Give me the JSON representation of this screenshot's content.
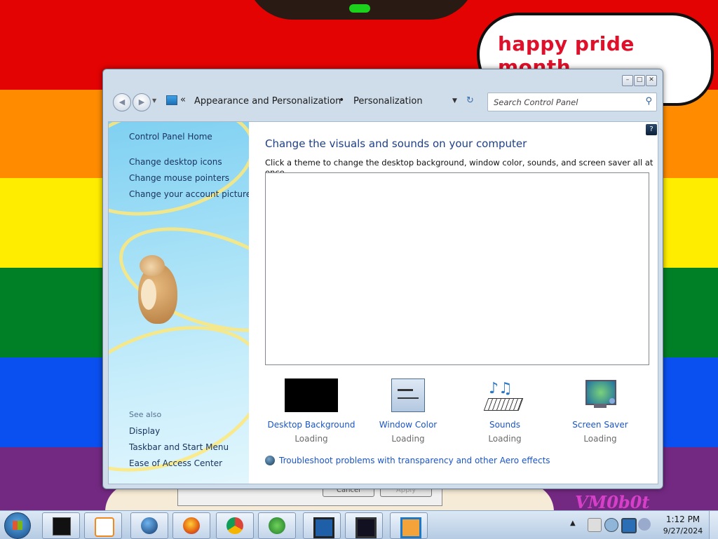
{
  "wallpaper": {
    "stripe_colors": [
      "#e40303",
      "#ff8c00",
      "#ffed00",
      "#008026",
      "#0a4ff0",
      "#732982"
    ],
    "speech_bubble_text": "happy pride month",
    "vm_logo_text": "VM0b0t"
  },
  "background_dialog": {
    "cancel_label": "Cancel",
    "apply_label": "Apply"
  },
  "window": {
    "breadcrumb": {
      "prefix": "«",
      "items": [
        "Appearance and Personalization",
        "Personalization"
      ],
      "separator": "•"
    },
    "search": {
      "placeholder": "Search Control Panel"
    },
    "left_pane": {
      "home_link": "Control Panel Home",
      "tasks": [
        "Change desktop icons",
        "Change mouse pointers",
        "Change your account picture"
      ],
      "see_also_heading": "See also",
      "see_also": [
        "Display",
        "Taskbar and Start Menu",
        "Ease of Access Center"
      ]
    },
    "main": {
      "help_glyph": "?",
      "title": "Change the visuals and sounds on your computer",
      "subtitle": "Click a theme to change the desktop background, window color, sounds, and screen saver all at once.",
      "options": [
        {
          "label": "Desktop Background",
          "status": "Loading",
          "icon": "desktop-background-icon"
        },
        {
          "label": "Window Color",
          "status": "Loading",
          "icon": "window-color-icon"
        },
        {
          "label": "Sounds",
          "status": "Loading",
          "icon": "sounds-icon"
        },
        {
          "label": "Screen Saver",
          "status": "Loading",
          "icon": "screen-saver-icon"
        }
      ],
      "troubleshoot_link": "Troubleshoot problems with transparency and other Aero effects"
    }
  },
  "taskbar": {
    "pinned": [
      "terminal-icon",
      "media-player-icon",
      "globe-icon",
      "firefox-icon",
      "chrome-icon",
      "download-manager-icon",
      "monitor-icon",
      "display-settings-icon",
      "virtualbox-icon"
    ],
    "clock": {
      "time": "1:12 PM",
      "date": "9/27/2024"
    }
  }
}
